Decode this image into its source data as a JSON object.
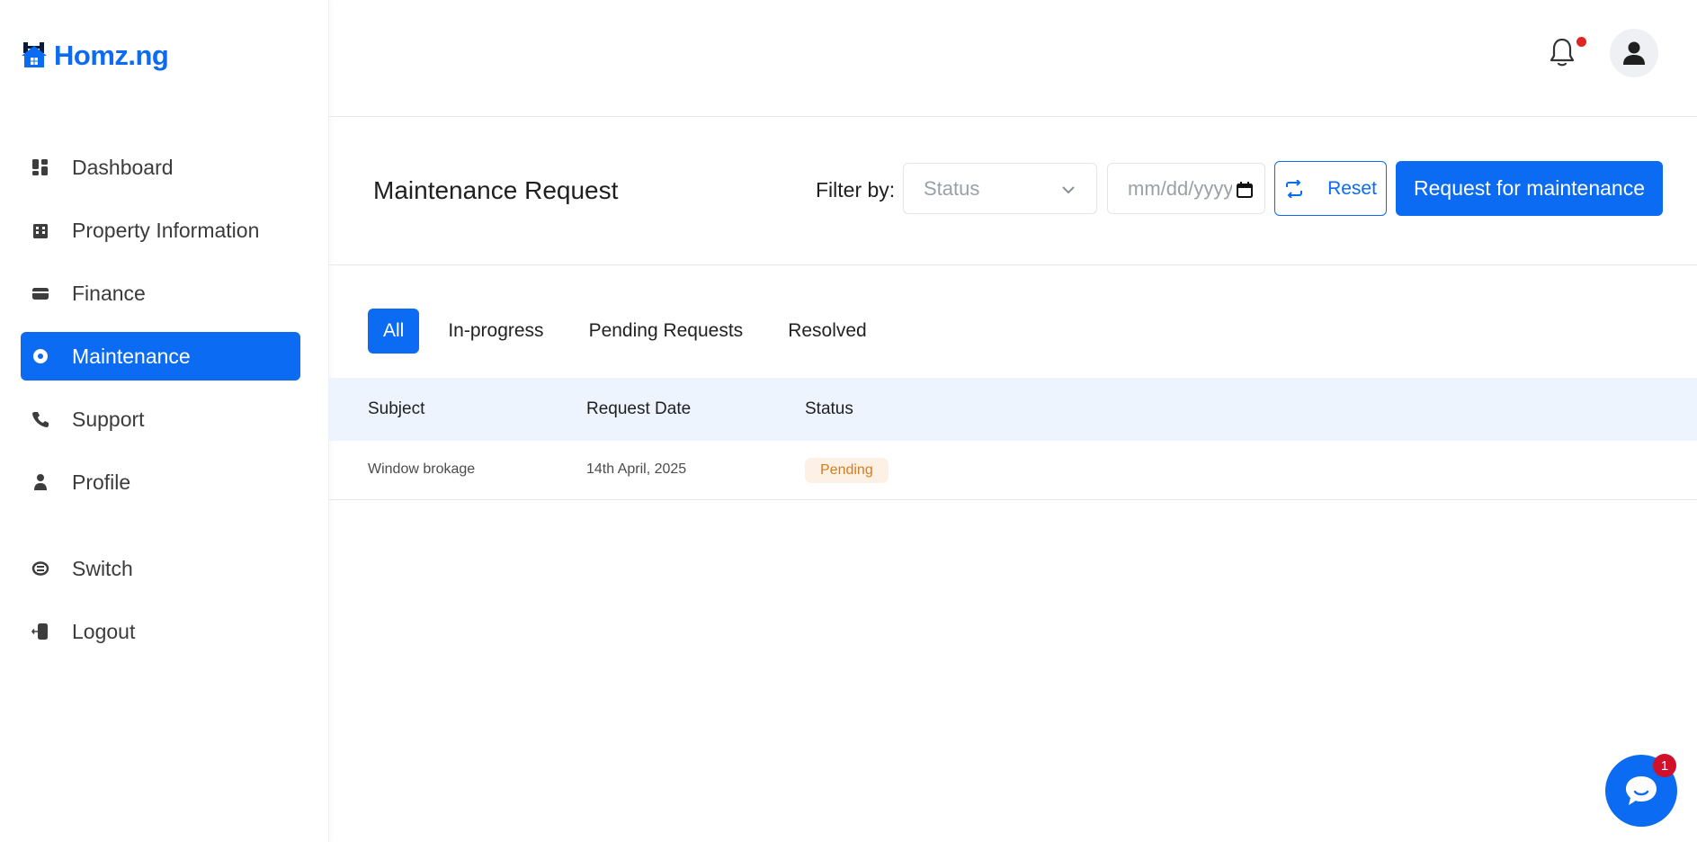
{
  "brand": {
    "name": "Homz.ng",
    "color": "#0b6bf2"
  },
  "sidebar": {
    "items": [
      {
        "label": "Dashboard",
        "icon": "dashboard-icon"
      },
      {
        "label": "Property Information",
        "icon": "building-icon"
      },
      {
        "label": "Finance",
        "icon": "wallet-icon"
      },
      {
        "label": "Maintenance",
        "icon": "maintenance-icon",
        "active": true
      },
      {
        "label": "Support",
        "icon": "phone-icon"
      },
      {
        "label": "Profile",
        "icon": "person-icon"
      }
    ],
    "bottom_items": [
      {
        "label": "Switch",
        "icon": "switch-icon"
      },
      {
        "label": "Logout",
        "icon": "logout-icon"
      }
    ]
  },
  "header": {
    "notification_icon": "bell-icon",
    "has_unread_notifications": true,
    "avatar_icon": "user-icon"
  },
  "page": {
    "title": "Maintenance Request",
    "filter_label": "Filter by:",
    "status_select": {
      "placeholder": "Status"
    },
    "date_input": {
      "placeholder": "mm/dd/yyyy"
    },
    "reset_label": "Reset",
    "request_button_label": "Request for maintenance"
  },
  "tabs": [
    {
      "label": "All",
      "active": true
    },
    {
      "label": "In-progress"
    },
    {
      "label": "Pending Requests"
    },
    {
      "label": "Resolved"
    }
  ],
  "table": {
    "columns": [
      "Subject",
      "Request Date",
      "Status"
    ],
    "rows": [
      {
        "subject": "Window brokage",
        "request_date": "14th April, 2025",
        "status": "Pending"
      }
    ]
  },
  "chat_widget": {
    "unread_count": "1"
  },
  "colors": {
    "accent": "#0b6bf2",
    "table_header_bg": "#edf4fe",
    "pending_badge_bg": "#fdf1e6",
    "pending_badge_text": "#d97a1c",
    "notification_dot": "#e02424"
  }
}
